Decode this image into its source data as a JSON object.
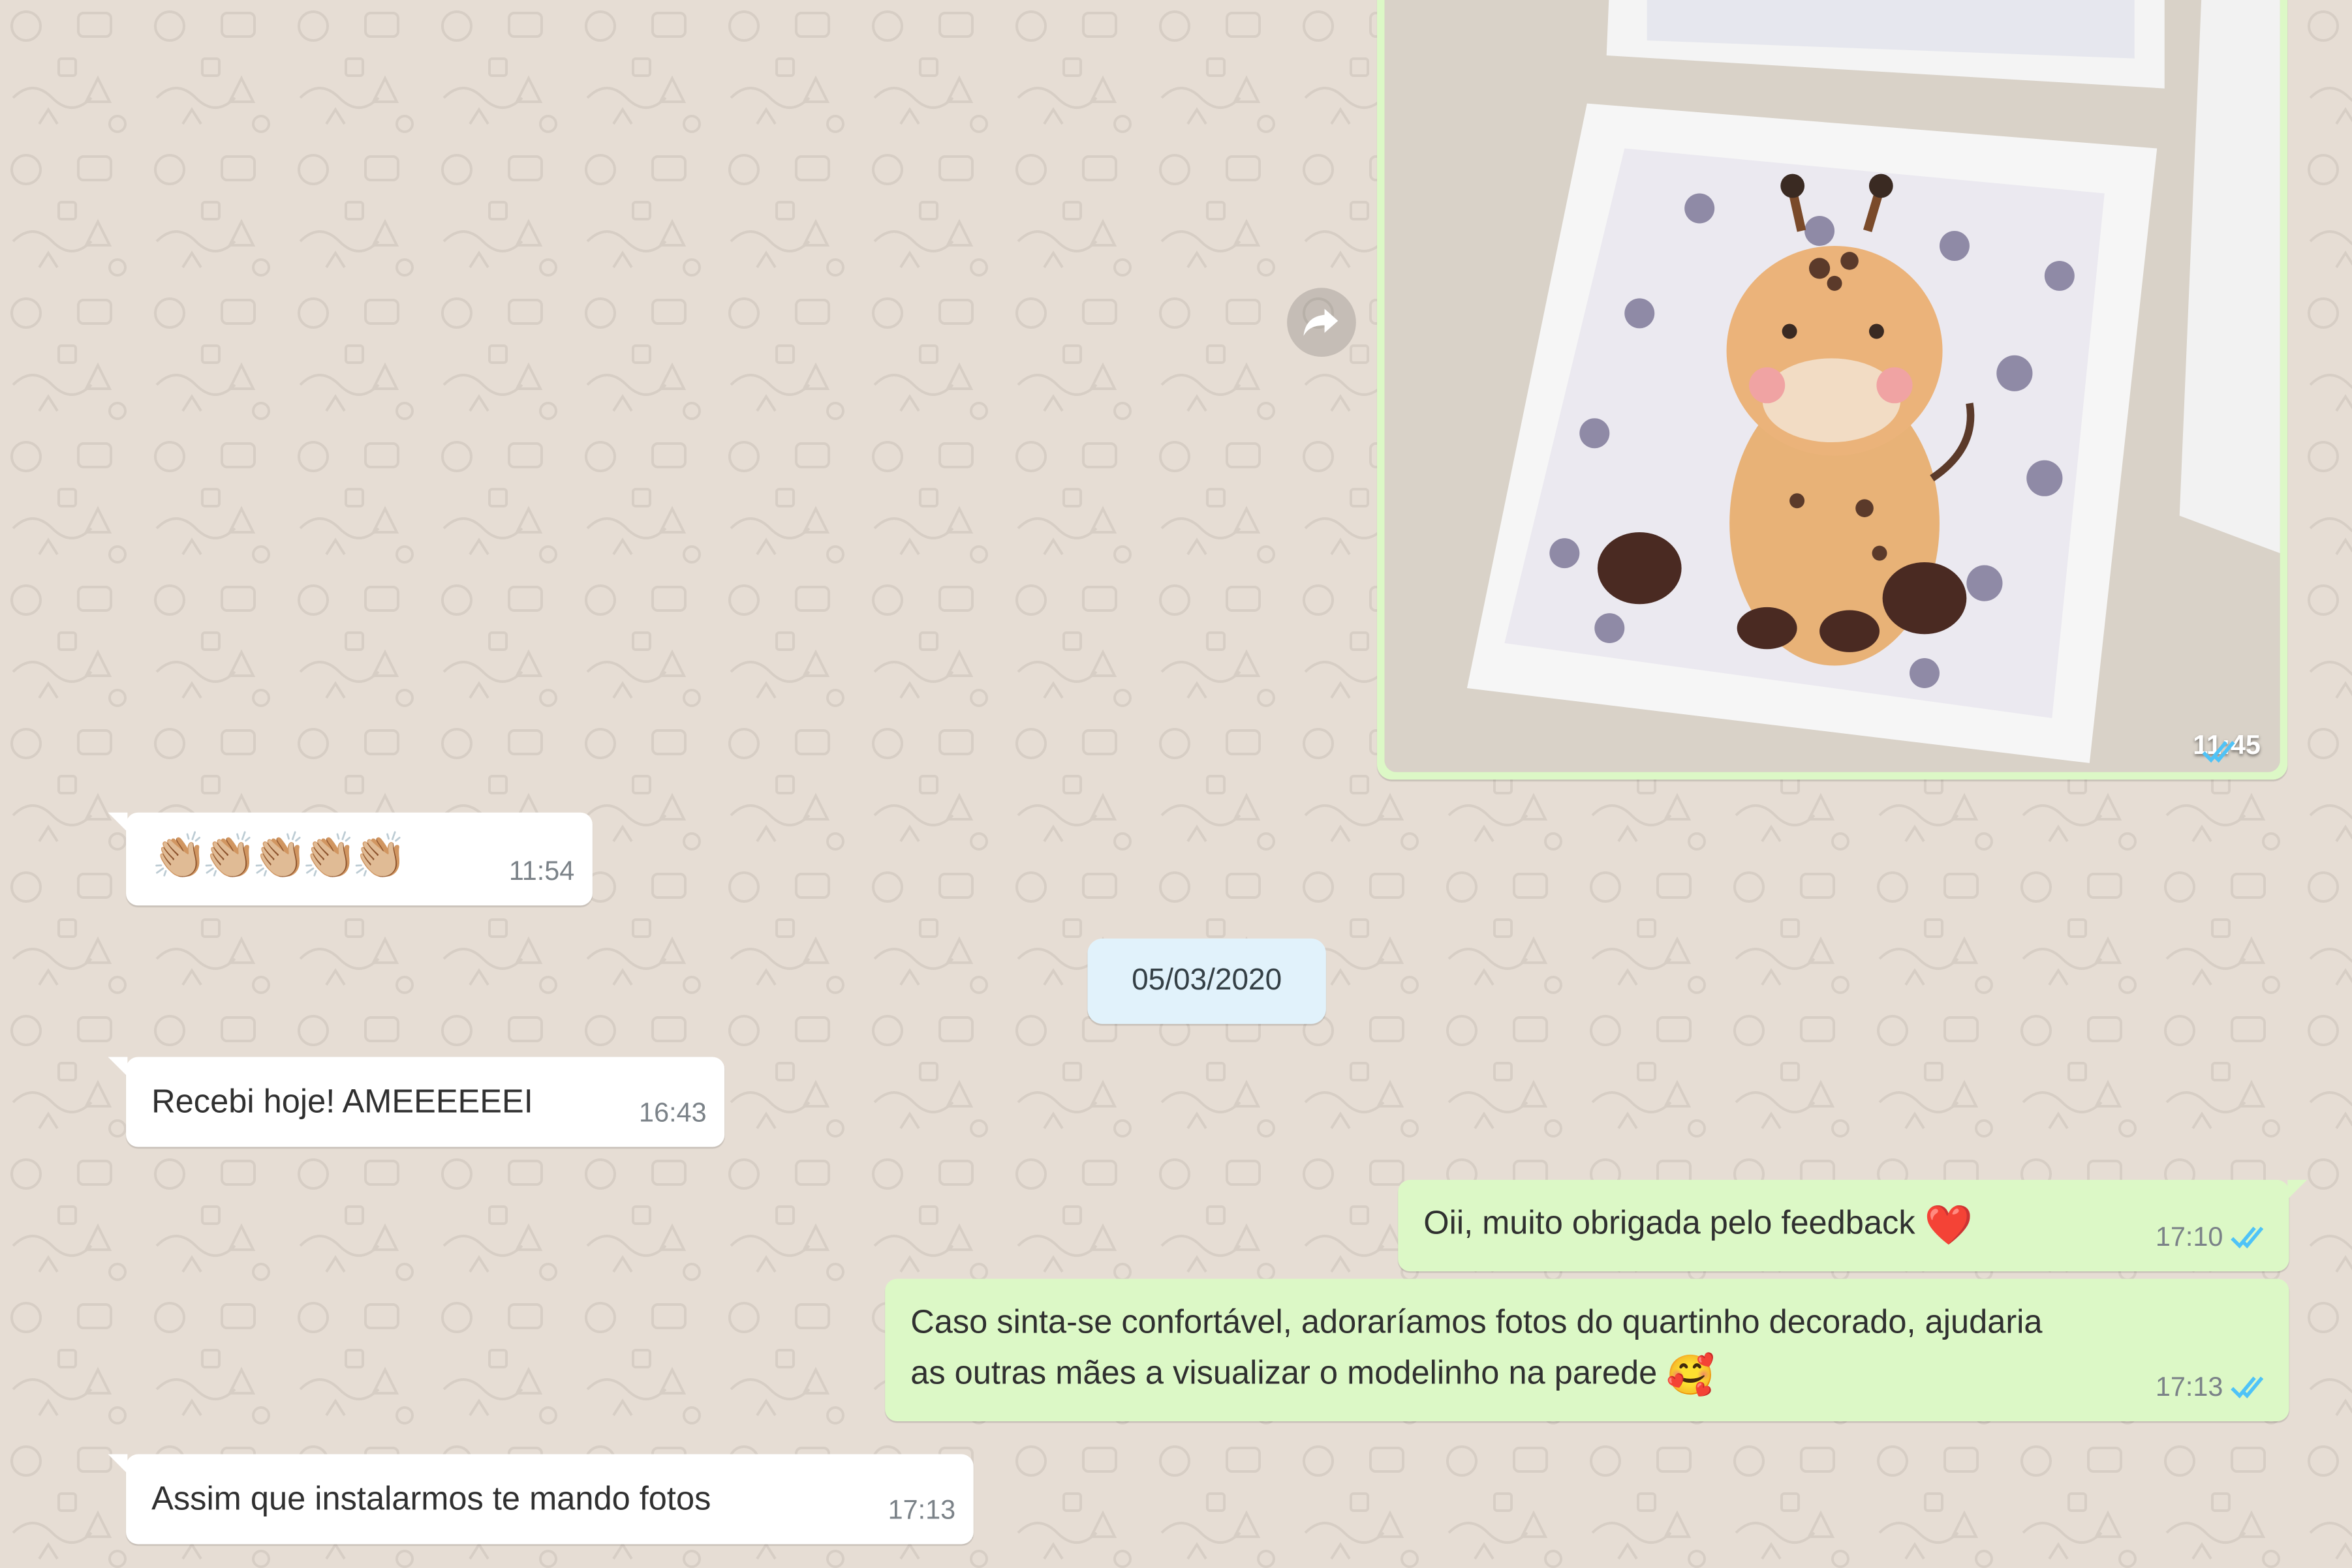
{
  "chat": {
    "messages": [
      {
        "id": "photo",
        "direction": "out",
        "type": "image",
        "time": "11:45",
        "status": "read"
      },
      {
        "id": "clap",
        "direction": "in",
        "type": "emoji",
        "emoji": "👏🏼👏🏼👏🏼👏🏼👏🏼",
        "time": "11:54"
      },
      {
        "id": "received",
        "direction": "in",
        "text": "Recebi hoje! AMEEEEEEI",
        "time": "16:43"
      },
      {
        "id": "thanks",
        "direction": "out",
        "text": "Oii, muito obrigada pelo feedback",
        "emoji": "❤️",
        "time": "17:10",
        "status": "read"
      },
      {
        "id": "request",
        "direction": "out",
        "text_line1": "Caso sinta-se confortável, adoraríamos fotos do quartinho decorado, ajudaria",
        "text_line2": "as outras mães a visualizar o modelinho na parede",
        "emoji": "🥰",
        "time": "17:13",
        "status": "read"
      },
      {
        "id": "reply",
        "direction": "in",
        "text": "Assim que instalarmos te mando fotos",
        "time": "17:13"
      }
    ],
    "date_separator": "05/03/2020"
  },
  "icons": {
    "forward": "forward-icon",
    "read_receipt": "double-check-icon",
    "heart": "red-heart-emoji",
    "smiling_hearts": "smiling-face-with-hearts-emoji",
    "clap": "clapping-hands-emoji"
  },
  "colors": {
    "wallpaper": "#e6ddd4",
    "incoming_bubble": "#ffffff",
    "outgoing_bubble": "#dcf8c6",
    "date_pill": "#e1f2fb",
    "read_tick": "#4fc3f7",
    "timestamp": "#7b8288"
  }
}
